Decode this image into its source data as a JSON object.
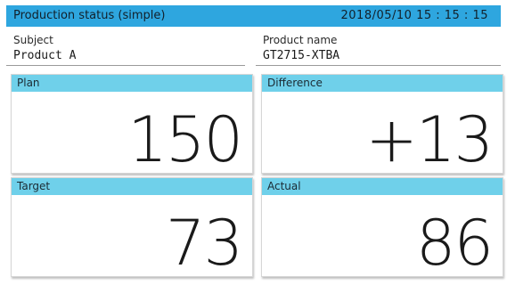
{
  "header": {
    "title": "Production status (simple)",
    "datetime": "2018/05/10  15 : 15 : 15"
  },
  "fields": {
    "subject": {
      "label": "Subject",
      "value": "Product A"
    },
    "product_name": {
      "label": "Product name",
      "value": "GT2715-XTBA"
    }
  },
  "cards": {
    "plan": {
      "label": "Plan",
      "value": "150"
    },
    "difference": {
      "label": "Difference",
      "value": "+13"
    },
    "target": {
      "label": "Target",
      "value": "73"
    },
    "actual": {
      "label": "Actual",
      "value": "86"
    }
  },
  "colors": {
    "header_bg": "#2ea6df",
    "card_bar_bg": "#6fd0ea"
  }
}
